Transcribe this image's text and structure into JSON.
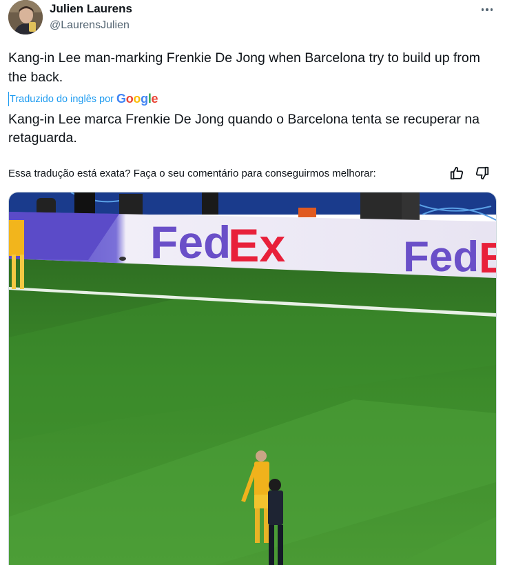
{
  "author": {
    "name": "Julien Laurens",
    "handle": "@LaurensJulien"
  },
  "tweet": {
    "text": "Kang-in Lee man-marking Frenkie De Jong when Barcelona try to build up from the back."
  },
  "translation": {
    "label": "Traduzido do inglês por",
    "provider": "Google",
    "text": "Kang-in Lee marca Frenkie De Jong quando o Barcelona tenta se recuperar na retaguarda."
  },
  "feedback": {
    "question": "Essa tradução está exata? Faça o seu comentário para conseguirmos melhorar:"
  },
  "media": {
    "board_text_1": "FedEx",
    "board_text_2": "FedE"
  },
  "colors": {
    "link": "#1d9bf0",
    "pitch": "#3f8f2c",
    "board": "#ebe7f5",
    "fedex_purple": "#4d148c",
    "fedex_red": "#ff2b2b"
  }
}
